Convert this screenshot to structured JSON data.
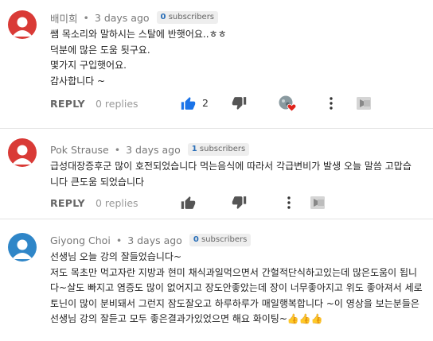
{
  "comments": [
    {
      "author": "배미희",
      "time": "3 days ago",
      "subscribers": {
        "count": "0",
        "label": "subscribers"
      },
      "lines": [
        "쌤 목소리와 말하시는 스탈에 반햇어요..ㅎㅎ",
        "덕분에 많은 도움 됫구요.",
        "몇가지 구입햇어요.",
        "감사합니다 ~"
      ],
      "reply_label": "REPLY",
      "replies_label": "0 replies",
      "like_count": "2",
      "liked": true,
      "creator_heart": true,
      "avatar_color": "#d93a36"
    },
    {
      "author": "Pok Strause",
      "time": "3 days ago",
      "subscribers": {
        "count": "1",
        "label": "subscribers"
      },
      "lines": [
        "급성대장증후군   많이 호전되었습니다 먹는음식에 따라서 각급변비가 발생 오늘 말씀 고맙습",
        "니다 큰도움 되었습니다"
      ],
      "reply_label": "REPLY",
      "replies_label": "0 replies",
      "avatar_color": "#d93a36"
    },
    {
      "author": "Giyong Choi",
      "time": "3 days ago",
      "subscribers": {
        "count": "0",
        "label": "subscribers"
      },
      "lines": [
        "선생님 오늘 강의 잘들었습니다~",
        "저도 목초만 먹고자란 지방과 현미 채식과일먹으면서 간헐적단식하고있는데 많은도움이 됩니",
        "다~살도 빠지고 염증도 많이 없어지고 장도안좋았는데 장이 너무좋아지고 위도 좋아져서 세로",
        "토닌이 많이 분비돼서 그런지 잠도잘오고 하루하루가 매일행복합니다 ~이 영상을 보는분들은",
        "선생님 강의 잘듣고 모두 좋은결과가있었으면 해요  화이팅~👍👍👍"
      ],
      "avatar_color": "#2f86c8"
    }
  ],
  "colors": {
    "accent": "#1a73e8",
    "icon_gray": "#606060"
  },
  "icons": [
    "thumbs-up-icon",
    "thumbs-down-icon",
    "creator-heart-icon",
    "more-vert-icon",
    "translate-icon"
  ]
}
